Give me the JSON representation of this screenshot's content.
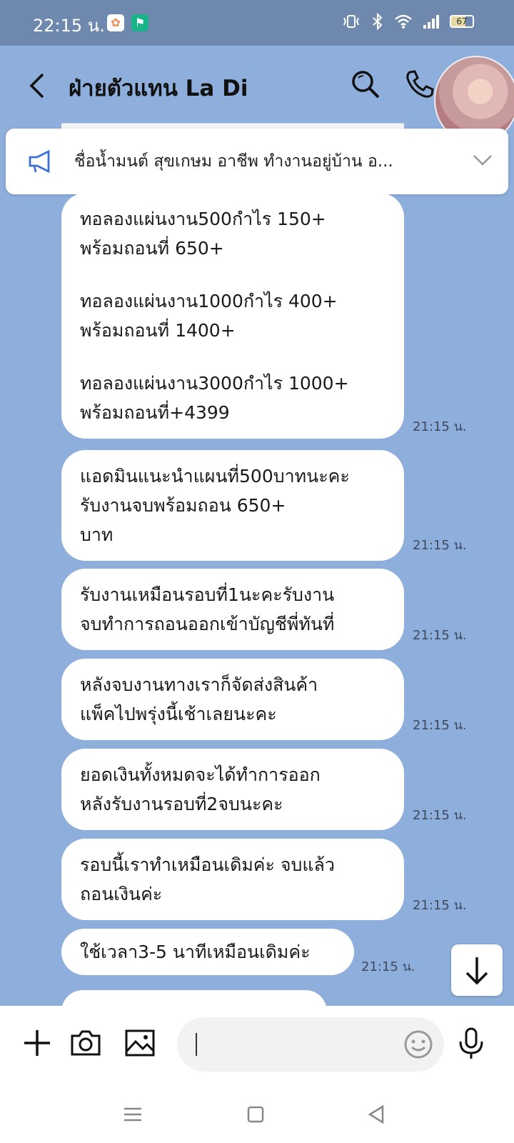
{
  "status_bar": {
    "time": "22:15 น.",
    "battery": "67"
  },
  "header": {
    "title": "ฝ่ายตัวแทน La Di"
  },
  "announcement": {
    "text": "ชื่อน้ำมนต์ สุขเกษม อาชีพ ทำงานอยู่บ้าน อ..."
  },
  "messages": [
    {
      "paragraphs": [
        [
          "ทอลองแผ่นงาน500กำไร 150+",
          "พร้อมถอนที่ 650+"
        ],
        [
          "ทอลองแผ่นงาน1000กำไร 400+",
          "พร้อมถอนที่ 1400+"
        ],
        [
          "ทอลองแผ่นงาน3000กำไร 1000+",
          "พร้อมถอนที่+4399"
        ]
      ],
      "time": "21:15 น."
    },
    {
      "lines": [
        "แอดมินแนะนำแผนที่500บาทนะคะ",
        "รับงานจบพร้อมถอน 650+",
        "บาท"
      ],
      "time": "21:15 น."
    },
    {
      "lines": [
        "รับงานเหมือนรอบที่1นะคะรับงาน",
        "จบทำการถอนออกเข้าบัญชีพี่ทันที่"
      ],
      "time": "21:15 น."
    },
    {
      "lines": [
        "หลังจบงานทางเราก็จัดส่งสินค้า",
        "แพ็คไปพรุ่งนี้เช้าเลยนะคะ"
      ],
      "time": "21:15 น."
    },
    {
      "lines": [
        "ยอดเงินทั้งหมดจะได้ทำการออก",
        "หลังรับงานรอบที่2จบนะคะ"
      ],
      "time": "21:15 น."
    },
    {
      "lines": [
        "รอบนี้เราทำเหมือนเดิมค่ะ จบแล้ว",
        "ถอนเงินค่ะ"
      ],
      "time": "21:15 น."
    },
    {
      "lines": [
        "ใช้เวลา3-5 นาทีเหมือนเดิมค่ะ"
      ],
      "time": "21:15 น."
    }
  ],
  "input": {
    "placeholder": ""
  },
  "colors": {
    "chat_background": "#8eaedb",
    "status_bar": "#6f88ad",
    "bubble": "#ffffff"
  },
  "icons": [
    "back-icon",
    "search-icon",
    "phone-icon",
    "megaphone-icon",
    "chevron-down-icon",
    "plus-icon",
    "camera-icon",
    "image-icon",
    "emoji-icon",
    "mic-icon",
    "arrow-down-icon"
  ]
}
